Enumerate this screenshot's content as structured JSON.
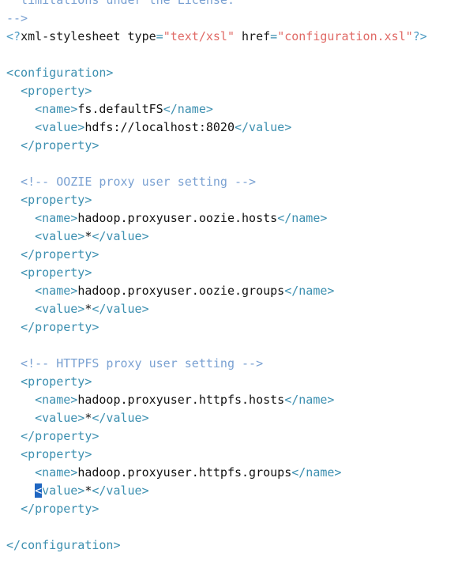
{
  "editor": {
    "language": "xml",
    "lines": [
      {
        "kind": "comment",
        "text": "  limitations under the License."
      },
      {
        "kind": "comment",
        "text": "-->"
      },
      {
        "kind": "pi",
        "prefix": "<?",
        "name": "xml-stylesheet",
        "attr1_name": "type",
        "attr1_value": "\"text/xsl\"",
        "attr2_name": "href",
        "attr2_value": "\"configuration.xsl\"",
        "suffix": "?>"
      },
      {
        "kind": "blank",
        "text": ""
      },
      {
        "kind": "open",
        "indent": "",
        "tag": "<configuration>"
      },
      {
        "kind": "open",
        "indent": "  ",
        "tag": "<property>"
      },
      {
        "kind": "element",
        "indent": "    ",
        "open": "<name>",
        "value": "fs.defaultFS",
        "close": "</name>"
      },
      {
        "kind": "element",
        "indent": "    ",
        "open": "<value>",
        "value": "hdfs://localhost:8020",
        "close": "</value>"
      },
      {
        "kind": "open",
        "indent": "  ",
        "tag": "</property>"
      },
      {
        "kind": "blank",
        "text": ""
      },
      {
        "kind": "comment",
        "text": "  <!-- OOZIE proxy user setting -->"
      },
      {
        "kind": "open",
        "indent": "  ",
        "tag": "<property>"
      },
      {
        "kind": "element",
        "indent": "    ",
        "open": "<name>",
        "value": "hadoop.proxyuser.oozie.hosts",
        "close": "</name>"
      },
      {
        "kind": "element",
        "indent": "    ",
        "open": "<value>",
        "value": "*",
        "close": "</value>"
      },
      {
        "kind": "open",
        "indent": "  ",
        "tag": "</property>"
      },
      {
        "kind": "open",
        "indent": "  ",
        "tag": "<property>"
      },
      {
        "kind": "element",
        "indent": "    ",
        "open": "<name>",
        "value": "hadoop.proxyuser.oozie.groups",
        "close": "</name>"
      },
      {
        "kind": "element",
        "indent": "    ",
        "open": "<value>",
        "value": "*",
        "close": "</value>"
      },
      {
        "kind": "open",
        "indent": "  ",
        "tag": "</property>"
      },
      {
        "kind": "blank",
        "text": ""
      },
      {
        "kind": "comment",
        "text": "  <!-- HTTPFS proxy user setting -->"
      },
      {
        "kind": "open",
        "indent": "  ",
        "tag": "<property>"
      },
      {
        "kind": "element",
        "indent": "    ",
        "open": "<name>",
        "value": "hadoop.proxyuser.httpfs.hosts",
        "close": "</name>"
      },
      {
        "kind": "element",
        "indent": "    ",
        "open": "<value>",
        "value": "*",
        "close": "</value>"
      },
      {
        "kind": "open",
        "indent": "  ",
        "tag": "</property>"
      },
      {
        "kind": "open",
        "indent": "  ",
        "tag": "<property>"
      },
      {
        "kind": "element",
        "indent": "    ",
        "open": "<name>",
        "value": "hadoop.proxyuser.httpfs.groups",
        "close": "</name>"
      },
      {
        "kind": "element",
        "indent": "    ",
        "open": "<value>",
        "value": "*",
        "close": "</value>",
        "cursor": true
      },
      {
        "kind": "open",
        "indent": "  ",
        "tag": "</property>"
      },
      {
        "kind": "blank",
        "text": ""
      },
      {
        "kind": "open",
        "indent": "",
        "tag": "</configuration>"
      }
    ]
  },
  "colors": {
    "comment": "#7aa1d2",
    "tag": "#3c8fb0",
    "text": "#111111",
    "string": "#e06a66",
    "cursor": "#1f66c1"
  }
}
